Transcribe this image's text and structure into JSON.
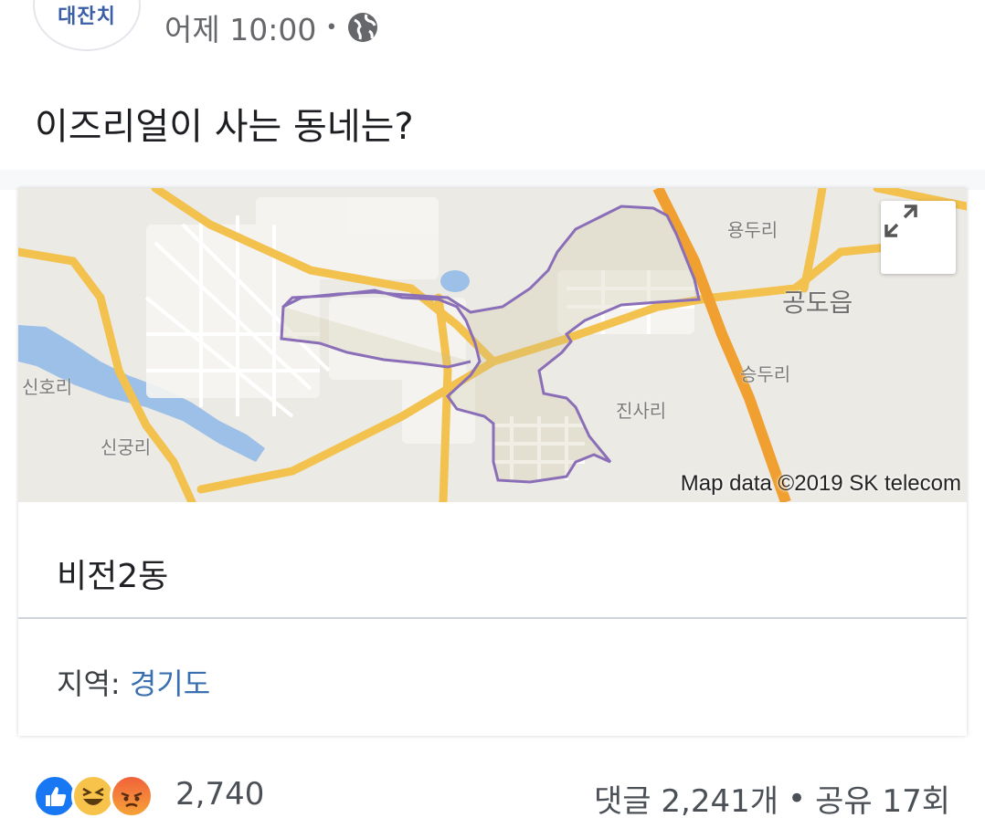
{
  "header": {
    "avatar_text": "대잔치",
    "timestamp": "어제 10:00",
    "separator": "•",
    "privacy_icon": "globe-icon"
  },
  "post": {
    "text": "이즈리얼이 사는 동네는?"
  },
  "map_card": {
    "map_labels": {
      "yongduri": "용두리",
      "gongdoeup": "공도읍",
      "seungduri": "승두리",
      "jinsari": "진사리",
      "sinhori": "신호리",
      "singungri": "신궁리"
    },
    "credit": "Map data ©2019 SK telecom",
    "expand_icon": "expand-icon",
    "place_name": "비전2동",
    "region_label": "지역: ",
    "region_value": "경기도"
  },
  "footer": {
    "reaction_icons": [
      "like-icon",
      "haha-icon",
      "angry-icon"
    ],
    "reaction_count": "2,740",
    "comments": "댓글 2,241개",
    "separator": "•",
    "shares": "공유 17회"
  },
  "colors": {
    "link": "#3a6fb0",
    "boundary": "#8a6fb8",
    "road_major": "#f2c14e",
    "highway": "#f0a030",
    "water": "#9cc0e8"
  }
}
